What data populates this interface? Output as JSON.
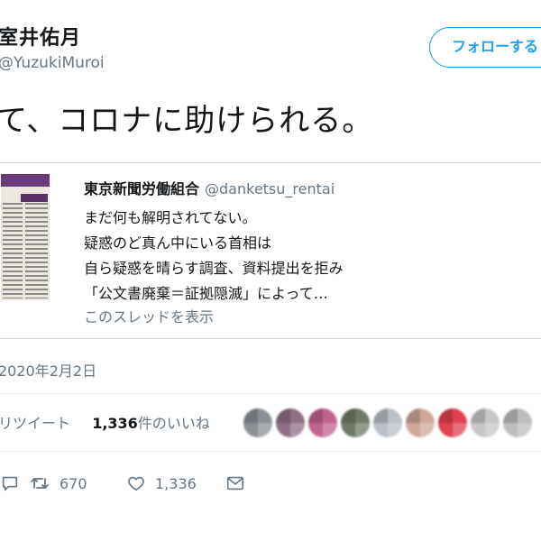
{
  "tweet": {
    "author_name": "室井佑月",
    "author_handle": "@YuzukiMuroi",
    "follow_label": "フォローする",
    "text": "て、コロナに助けられる。",
    "date": "2020年2月2日"
  },
  "quote": {
    "author_name": "東京新聞労働組合",
    "author_handle": "@danketsu_rentai",
    "lines": [
      "まだ何も解明されてない。",
      "疑惑のど真ん中にいる首相は",
      "自ら疑惑を晴らす調査、資料提出を拒み",
      "「公文書廃棄＝証拠隠滅」によって…"
    ],
    "thread_link": "このスレッドを表示"
  },
  "stats": {
    "retweets_label": "リツイート",
    "likes_count": "1,336",
    "likes_label": "件のいいね"
  },
  "likers": [
    {
      "color": "#8a8f96"
    },
    {
      "color": "#8f6f86"
    },
    {
      "color": "#c0628e"
    },
    {
      "color": "#6f7a66"
    },
    {
      "color": "#b9c0c7"
    },
    {
      "color": "#cfa89a"
    },
    {
      "color": "#e04050"
    },
    {
      "color": "#c7c7c7"
    },
    {
      "color": "#bdbdbd"
    }
  ],
  "actions": {
    "retweet_count": "670",
    "like_count": "1,336"
  },
  "colors": {
    "accent": "#1da1f2",
    "secondary_text": "#657786",
    "border": "#ccd6dd"
  }
}
